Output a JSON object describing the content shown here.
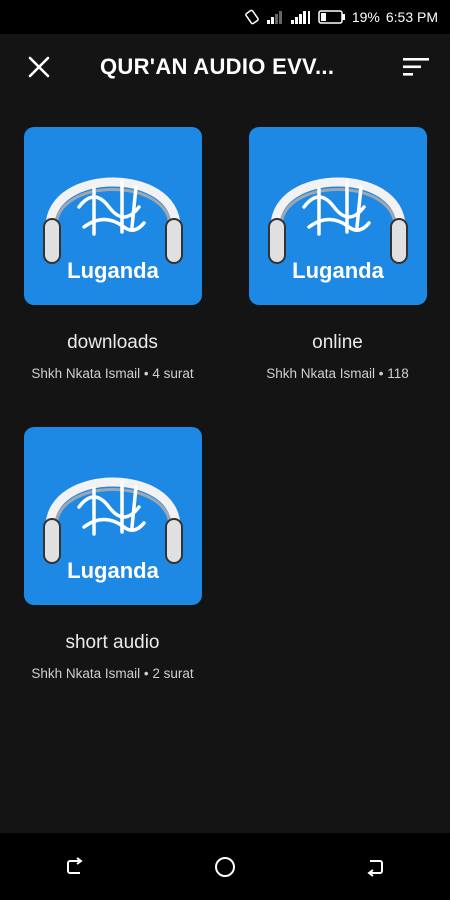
{
  "status_bar": {
    "battery_percent": "19%",
    "time": "6:53 PM",
    "icons": [
      "rotate-icon",
      "signal-icon",
      "signal-icon",
      "battery-icon"
    ]
  },
  "app_bar": {
    "title": "QUR'AN AUDIO EVV...",
    "close_icon": "close-icon",
    "sort_icon": "sort-icon"
  },
  "albums": [
    {
      "image_label": "Luganda",
      "name": "downloads",
      "meta": "Shkh Nkata Ismail  • 4 surat"
    },
    {
      "image_label": "Luganda",
      "name": "online",
      "meta": "Shkh Nkata Ismail  • 118"
    },
    {
      "image_label": "Luganda",
      "name": "short audio",
      "meta": "Shkh Nkata Ismail  • 2 surat"
    }
  ],
  "nav_bar": {
    "icons": [
      "recent-apps-icon",
      "home-icon",
      "back-icon"
    ]
  },
  "colors": {
    "background": "#141414",
    "thumb_blue": "#1e88e5",
    "system_bar": "#000000"
  }
}
